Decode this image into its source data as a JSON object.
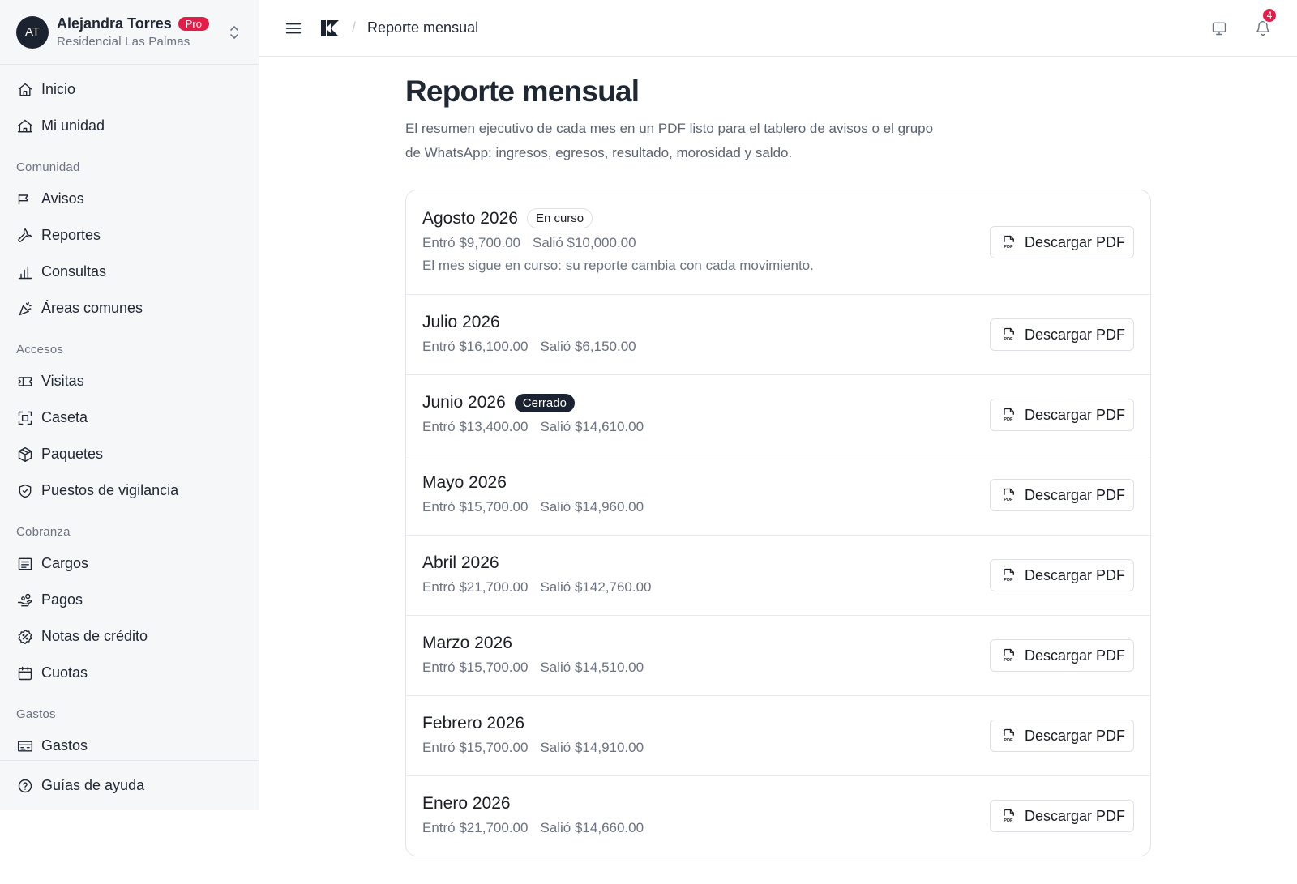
{
  "account": {
    "initials": "AT",
    "name": "Alejandra Torres",
    "badge": "Pro",
    "community": "Residencial Las Palmas"
  },
  "sidebar": {
    "top": [
      {
        "label": "Inicio",
        "icon": "home-icon"
      },
      {
        "label": "Mi unidad",
        "icon": "house-icon"
      }
    ],
    "sections": [
      {
        "title": "Comunidad",
        "items": [
          {
            "label": "Avisos",
            "icon": "megaphone-icon"
          },
          {
            "label": "Reportes",
            "icon": "wrench-icon"
          },
          {
            "label": "Consultas",
            "icon": "bar-chart-icon"
          },
          {
            "label": "Áreas comunes",
            "icon": "party-popper-icon"
          }
        ]
      },
      {
        "title": "Accesos",
        "items": [
          {
            "label": "Visitas",
            "icon": "ticket-icon"
          },
          {
            "label": "Caseta",
            "icon": "scan-icon"
          },
          {
            "label": "Paquetes",
            "icon": "package-icon"
          },
          {
            "label": "Puestos de vigilancia",
            "icon": "shield-check-icon"
          }
        ]
      },
      {
        "title": "Cobranza",
        "items": [
          {
            "label": "Cargos",
            "icon": "receipt-icon"
          },
          {
            "label": "Pagos",
            "icon": "hand-coins-icon"
          },
          {
            "label": "Notas de crédito",
            "icon": "badge-percent-icon"
          },
          {
            "label": "Cuotas",
            "icon": "calendar-icon"
          }
        ]
      },
      {
        "title": "Gastos",
        "items": [
          {
            "label": "Gastos",
            "icon": "receipt-text-icon"
          }
        ]
      }
    ],
    "footer": {
      "label": "Guías de ayuda",
      "icon": "help-circle-icon"
    }
  },
  "topbar": {
    "breadcrumb": "Reporte mensual",
    "notifications": "4"
  },
  "main": {
    "title": "Reporte mensual",
    "description": "El resumen ejecutivo de cada mes en un PDF listo para el tablero de avisos o el grupo de WhatsApp: ingresos, egresos, resultado, morosidad y saldo.",
    "download_label": "Descargar PDF",
    "reports": [
      {
        "month": "Agosto 2026",
        "tag": "En curso",
        "tag_style": "outline",
        "income": "Entró $9,700.00",
        "expense": "Salió $10,000.00",
        "note": "El mes sigue en curso: su reporte cambia con cada movimiento."
      },
      {
        "month": "Julio 2026",
        "tag": "",
        "income": "Entró $16,100.00",
        "expense": "Salió $6,150.00",
        "note": ""
      },
      {
        "month": "Junio 2026",
        "tag": "Cerrado",
        "tag_style": "dark",
        "income": "Entró $13,400.00",
        "expense": "Salió $14,610.00",
        "note": ""
      },
      {
        "month": "Mayo 2026",
        "tag": "",
        "income": "Entró $15,700.00",
        "expense": "Salió $14,960.00",
        "note": ""
      },
      {
        "month": "Abril 2026",
        "tag": "",
        "income": "Entró $21,700.00",
        "expense": "Salió $142,760.00",
        "note": ""
      },
      {
        "month": "Marzo 2026",
        "tag": "",
        "income": "Entró $15,700.00",
        "expense": "Salió $14,510.00",
        "note": ""
      },
      {
        "month": "Febrero 2026",
        "tag": "",
        "income": "Entró $15,700.00",
        "expense": "Salió $14,910.00",
        "note": ""
      },
      {
        "month": "Enero 2026",
        "tag": "",
        "income": "Entró $21,700.00",
        "expense": "Salió $14,660.00",
        "note": ""
      }
    ]
  }
}
